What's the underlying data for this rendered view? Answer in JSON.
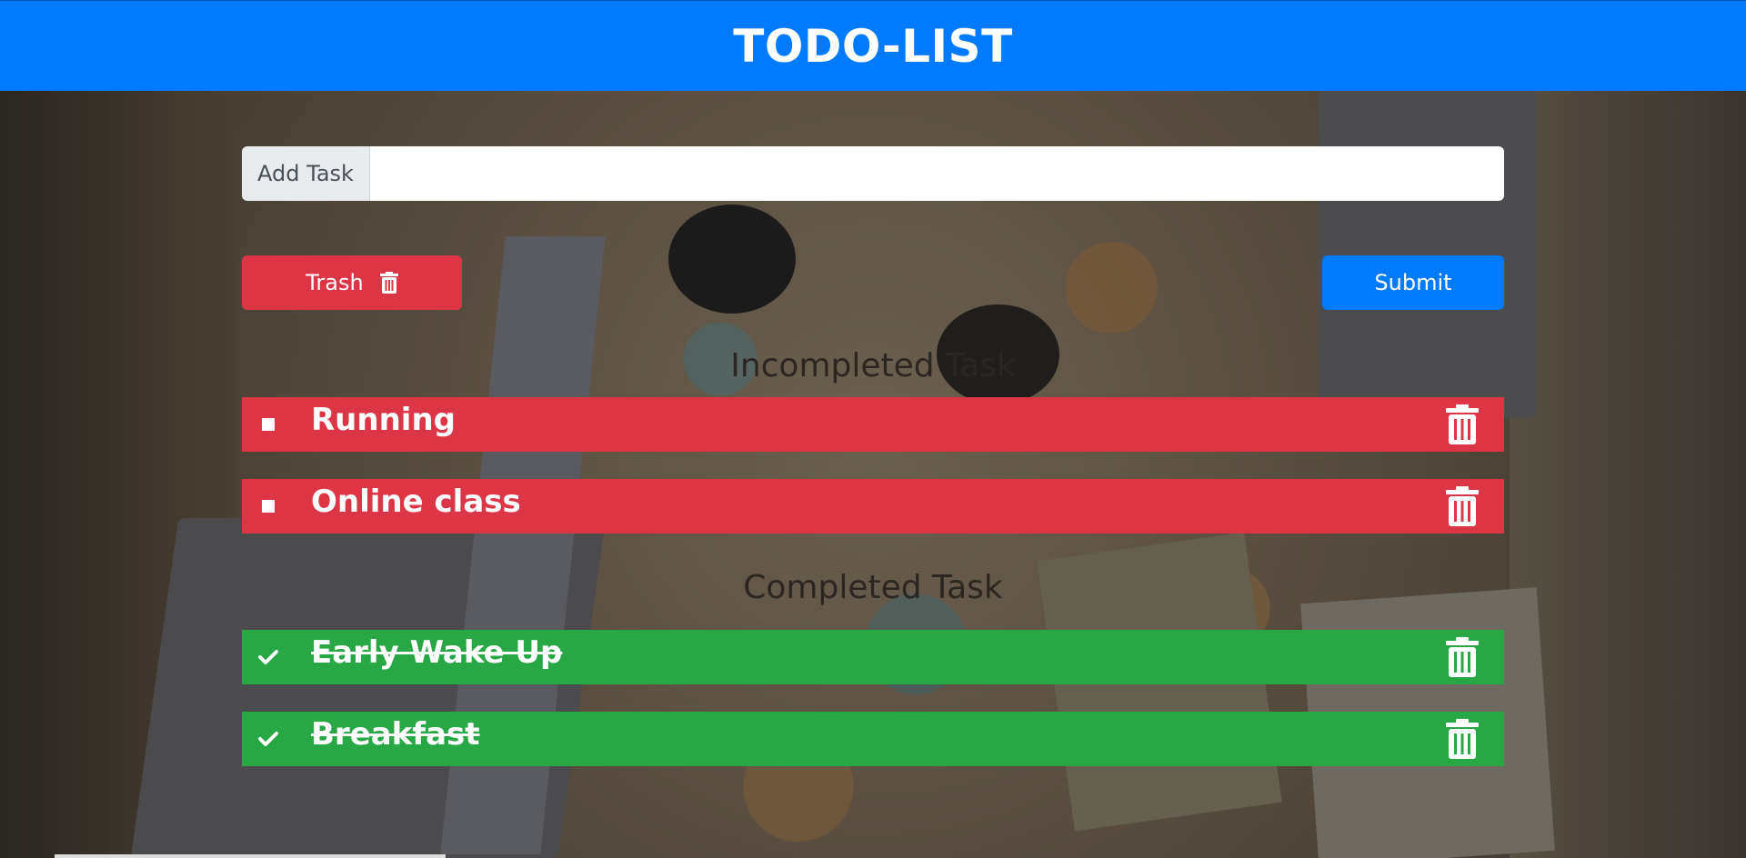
{
  "header": {
    "title": "TODO-LIST"
  },
  "add_task": {
    "label": "Add Task",
    "value": "",
    "placeholder": ""
  },
  "buttons": {
    "trash_label": "Trash",
    "submit_label": "Submit"
  },
  "sections": {
    "incomplete_title": "Incompleted Task",
    "complete_title": "Completed Task"
  },
  "incomplete_tasks": [
    {
      "label": "Running"
    },
    {
      "label": "Online class"
    }
  ],
  "complete_tasks": [
    {
      "label": "Early Wake Up"
    },
    {
      "label": "Breakfast"
    }
  ],
  "colors": {
    "primary": "#007bff",
    "danger": "#dc3545",
    "success": "#28a745"
  },
  "icons": {
    "trash": "trash-icon",
    "incomplete_marker": "square-icon",
    "complete_marker": "checkmark-icon"
  }
}
